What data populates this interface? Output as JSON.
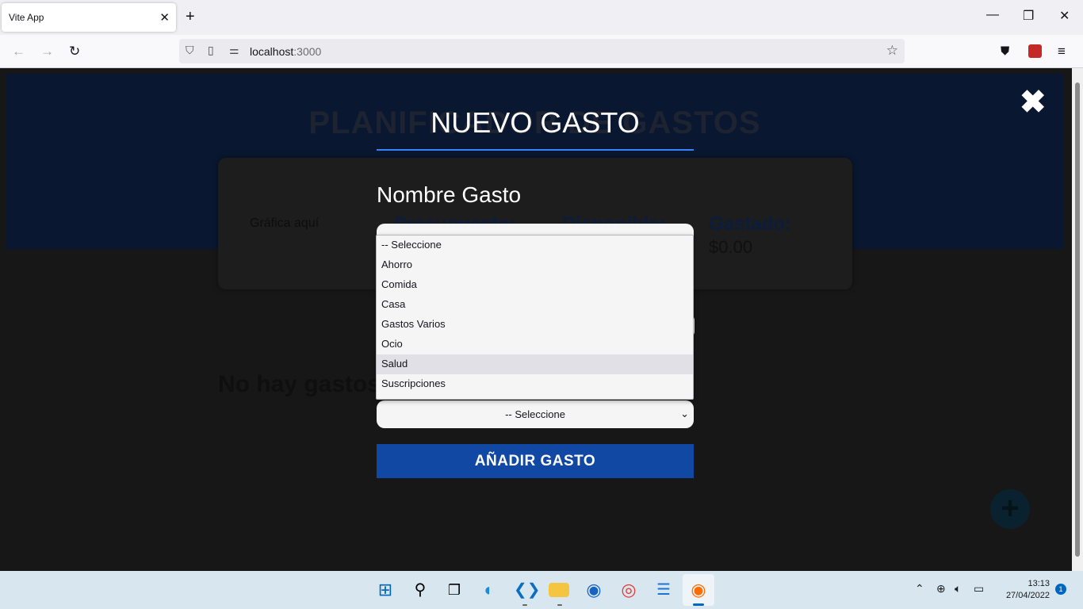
{
  "browser": {
    "tab_title": "Vite App",
    "tab_close": "✕",
    "new_tab": "+",
    "minimize": "—",
    "maximize": "❐",
    "close": "✕",
    "url_host": "localhost",
    "url_port": ":3000",
    "icons": [
      "back-arrow-icon",
      "forward-arrow-icon",
      "reload-icon",
      "shield-icon",
      "page-icon",
      "permissions-icon",
      "star-icon",
      "pocket-icon",
      "extension-icon",
      "menu-icon"
    ]
  },
  "app": {
    "title": "PLANIFICADOR DE GASTOS",
    "graph_placeholder": "Gráfica aquí",
    "presupuesto_label": "Presupuesto:",
    "disponible_label": "Disponible:",
    "gastado_label": "Gastado:",
    "gastado_value": "$0.00",
    "empty_message": "No hay gastos",
    "fab": "+"
  },
  "modal": {
    "close": "✖",
    "title": "NUEVO GASTO",
    "nombre_label": "Nombre Gasto",
    "select_value": "-- Seleccione",
    "select_arrow": "⌄",
    "submit": "AÑADIR GASTO",
    "options": [
      "-- Seleccione",
      "Ahorro",
      "Comida",
      "Casa",
      "Gastos Varios",
      "Ocio",
      "Salud",
      "Suscripciones"
    ],
    "highlighted_option": "Salud"
  },
  "taskbar": {
    "time": "13:13",
    "date": "27/04/2022",
    "notifications": "1",
    "icons": [
      "windows-start-icon",
      "search-icon",
      "task-view-icon",
      "edge-icon",
      "vscode-icon",
      "file-explorer-icon",
      "firefox-dev-icon",
      "chrome-icon",
      "notepad-icon",
      "firefox-icon"
    ],
    "tray_icons": [
      "chevron-up-icon",
      "globe-icon",
      "volume-icon",
      "battery-icon"
    ]
  },
  "colors": {
    "accent_blue": "#1048a4",
    "underline_blue": "#3b82f6",
    "header_bg": "#091730"
  }
}
